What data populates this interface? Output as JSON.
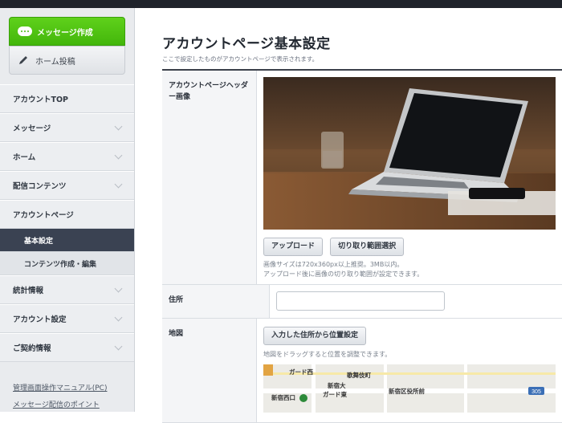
{
  "sidebar": {
    "compose_label": "メッセージ作成",
    "home_post_label": "ホーム投稿",
    "nav": [
      {
        "label": "アカウントTOP",
        "chevron": false
      },
      {
        "label": "メッセージ",
        "chevron": true
      },
      {
        "label": "ホーム",
        "chevron": true
      },
      {
        "label": "配信コンテンツ",
        "chevron": true
      },
      {
        "label": "アカウントページ",
        "chevron": false
      }
    ],
    "sub": [
      {
        "label": "基本設定",
        "active": true
      },
      {
        "label": "コンテンツ作成・編集",
        "active": false
      }
    ],
    "nav2": [
      {
        "label": "統計情報"
      },
      {
        "label": "アカウント設定"
      },
      {
        "label": "ご契約情報"
      }
    ],
    "links": [
      "管理画面操作マニュアル(PC)",
      "メッセージ配信のポイント"
    ]
  },
  "main": {
    "title": "アカウントページ基本設定",
    "subtitle": "ここで設定したものがアカウントページで表示されます。",
    "header_row": {
      "label": "アカウントページヘッダー画像",
      "upload_label": "アップロード",
      "crop_label": "切り取り範囲選択",
      "help1": "画像サイズは720x360px以上推奨。3MB以内。",
      "help2": "アップロード後に画像の切り取り範囲が設定できます。"
    },
    "address_row": {
      "label": "住所",
      "value": ""
    },
    "map_row": {
      "label": "地図",
      "button_label": "入力した住所から位置設定",
      "help": "地図をドラッグすると位置を調整できます。",
      "map_labels": [
        "ガード西",
        "歌舞伎町",
        "新宿大",
        "ガード東",
        "新宿区役所前",
        "新宿西口",
        "305"
      ]
    }
  },
  "colors": {
    "accent_green": "#4cc414",
    "sidebar_active": "#3a4252",
    "topbar": "#1f232b"
  }
}
